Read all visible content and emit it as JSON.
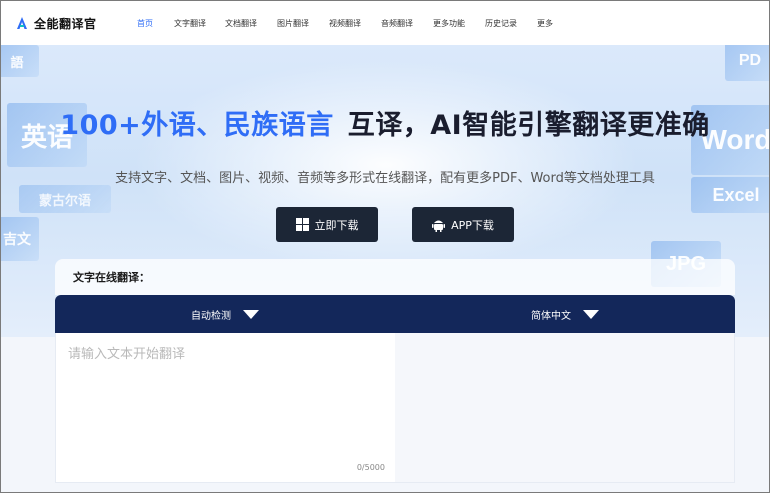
{
  "brand": {
    "name": "全能翻译官",
    "logo_color": "#2f6df6"
  },
  "nav": {
    "items": [
      {
        "label": "首页",
        "active": true
      },
      {
        "label": "文字翻译",
        "active": false
      },
      {
        "label": "文档翻译",
        "active": false
      },
      {
        "label": "图片翻译",
        "active": false
      },
      {
        "label": "视频翻译",
        "active": false
      },
      {
        "label": "音频翻译",
        "active": false
      },
      {
        "label": "更多功能",
        "active": false
      },
      {
        "label": "历史记录",
        "active": false
      },
      {
        "label": "更多",
        "active": false
      }
    ]
  },
  "hero": {
    "title_highlight": "100+外语、民族语言",
    "title_rest": "互译，AI智能引擎翻译更准确",
    "subtitle": "支持文字、文档、图片、视频、音频等多形式在线翻译，配有更多PDF、Word等文档处理工具",
    "download_button": "立即下载",
    "app_button": "APP下载",
    "deco_words": [
      "英语",
      "語",
      "蒙古尔语",
      "吉文",
      "PD",
      "Word",
      "Excel",
      "JPG"
    ]
  },
  "translator": {
    "section_label": "文字在线翻译：",
    "source_lang": "自动检测",
    "target_lang": "简体中文",
    "input_placeholder": "请输入文本开始翻译",
    "char_counter": "0/5000"
  },
  "colors": {
    "accent": "#2f6df6",
    "dark_button": "#1c2636",
    "lang_bar": "#13275a"
  }
}
